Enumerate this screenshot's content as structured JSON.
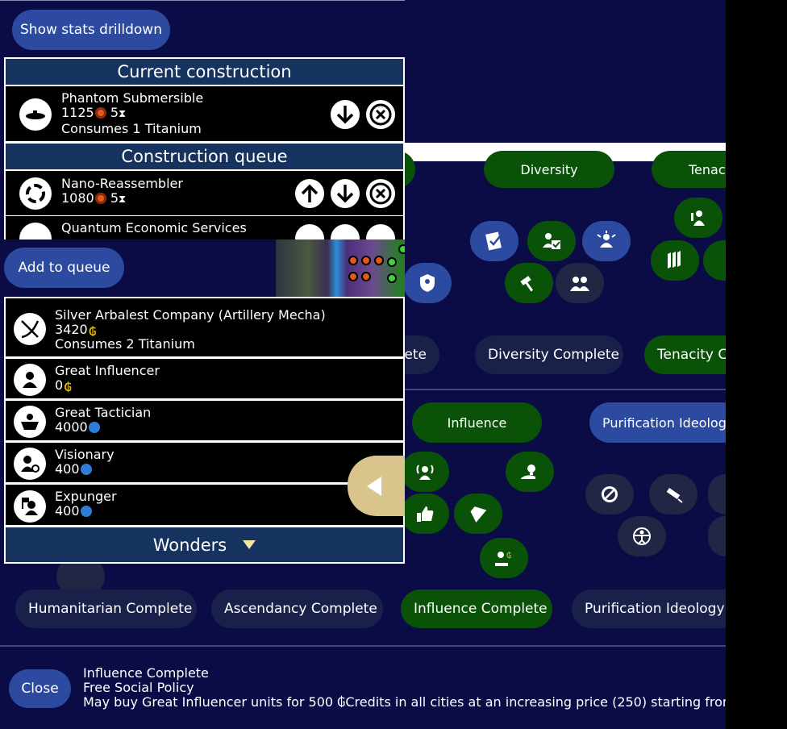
{
  "policies": {
    "top_branches": [
      {
        "label": "Diversity",
        "color": "green"
      },
      {
        "label": "Tenacity",
        "color": "green"
      }
    ],
    "top_completes": [
      {
        "label": "Altruism Complete"
      },
      {
        "label": "Diversity Complete"
      },
      {
        "label": "Tenacity Complete"
      }
    ],
    "mid_branches": [
      {
        "label": "Influence",
        "color": "green"
      },
      {
        "label": "Purification Ideology",
        "color": "blue"
      }
    ],
    "bottom_completes": [
      {
        "label": "Humanitarian Complete",
        "done": false
      },
      {
        "label": "Ascendancy Complete",
        "done": false
      },
      {
        "label": "Influence Complete",
        "done": true
      },
      {
        "label": "Purification Ideology Adopted",
        "done": false
      }
    ],
    "description": {
      "close_label": "Close",
      "lines": [
        "Influence Complete",
        "Free Social Policy",
        "May buy Great Influencer units for 500 ₲Credits in all cities at an increasing price (250) starting from"
      ]
    }
  },
  "city": {
    "stats_button": "Show stats drilldown",
    "current_header": "Current construction",
    "current": {
      "name": "Phantom Submersible",
      "cost": "1125",
      "turns": "5",
      "note": "Consumes 1 Titanium",
      "icon": "submarine-icon"
    },
    "queue_header": "Construction queue",
    "queue": [
      {
        "name": "Nano-Reassembler",
        "cost": "1080",
        "turns": "5",
        "icon": "recycle-icon"
      },
      {
        "name": "Quantum Economic Services",
        "cost": "",
        "turns": "",
        "icon": "globe-icon"
      }
    ],
    "add_button": "Add to queue",
    "buyables": [
      {
        "name": "Silver Arbalest Company (Artillery Mecha)",
        "cost": "3420",
        "currency": "credit",
        "note": "Consumes 2 Titanium",
        "icon": "crossbow-icon"
      },
      {
        "name": "Great Influencer",
        "cost": "0",
        "currency": "credit",
        "note": "",
        "icon": "influencer-icon"
      },
      {
        "name": "Great Tactician",
        "cost": "4000",
        "currency": "faith",
        "note": "",
        "icon": "tactician-icon"
      },
      {
        "name": "Visionary",
        "cost": "400",
        "currency": "faith",
        "note": "",
        "icon": "visionary-icon"
      },
      {
        "name": "Expunger",
        "cost": "400",
        "currency": "faith",
        "note": "",
        "icon": "expunger-icon"
      }
    ],
    "wonders_header": "Wonders"
  },
  "colors": {
    "panel_bg": "#0b0b46",
    "header_bg": "#16325e",
    "green_pill": "#0b5209",
    "blue_pill": "#2c4ba0",
    "gold_tab": "#d9c48c"
  }
}
